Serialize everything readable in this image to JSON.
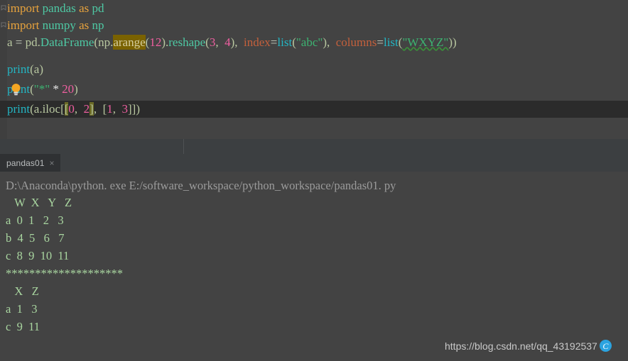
{
  "editor": {
    "lines": [
      {
        "id": "line-1",
        "tokens": [
          {
            "t": "import",
            "c": "kw"
          },
          {
            "t": " ",
            "c": "plain"
          },
          {
            "t": "pandas",
            "c": "ident"
          },
          {
            "t": " ",
            "c": "plain"
          },
          {
            "t": "as",
            "c": "kw"
          },
          {
            "t": " ",
            "c": "plain"
          },
          {
            "t": "pd",
            "c": "ident"
          }
        ],
        "text": "import pandas as pd"
      },
      {
        "id": "line-2",
        "tokens": [
          {
            "t": "import",
            "c": "kw"
          },
          {
            "t": " ",
            "c": "plain"
          },
          {
            "t": "numpy",
            "c": "ident"
          },
          {
            "t": " ",
            "c": "plain"
          },
          {
            "t": "as",
            "c": "kw"
          },
          {
            "t": " ",
            "c": "plain"
          },
          {
            "t": "np",
            "c": "ident"
          }
        ],
        "text": "import numpy as np"
      },
      {
        "id": "line-3",
        "tokens": [
          {
            "t": "a ",
            "c": "plain"
          },
          {
            "t": "= ",
            "c": "eq"
          },
          {
            "t": "pd",
            "c": "plain"
          },
          {
            "t": ".",
            "c": "punc"
          },
          {
            "t": "DataFrame",
            "c": "ident"
          },
          {
            "t": "(",
            "c": "punc"
          },
          {
            "t": "np",
            "c": "plain"
          },
          {
            "t": ".",
            "c": "punc"
          },
          {
            "t": "arange",
            "c": "arange-hl"
          },
          {
            "t": "(",
            "c": "punc"
          },
          {
            "t": "12",
            "c": "num"
          },
          {
            "t": ")",
            "c": "punc"
          },
          {
            "t": ".",
            "c": "punc"
          },
          {
            "t": "reshape",
            "c": "ident"
          },
          {
            "t": "(",
            "c": "punc"
          },
          {
            "t": "3",
            "c": "num"
          },
          {
            "t": ", ",
            "c": "punc"
          },
          {
            "t": " 4",
            "c": "num"
          },
          {
            "t": "), ",
            "c": "punc"
          },
          {
            "t": " index",
            "c": "kwarg"
          },
          {
            "t": "=",
            "c": "eq"
          },
          {
            "t": "list",
            "c": "fn"
          },
          {
            "t": "(",
            "c": "punc"
          },
          {
            "t": "\"abc\"",
            "c": "str"
          },
          {
            "t": "), ",
            "c": "punc"
          },
          {
            "t": " columns",
            "c": "kwarg"
          },
          {
            "t": "=",
            "c": "eq"
          },
          {
            "t": "list",
            "c": "fn"
          },
          {
            "t": "(",
            "c": "punc"
          },
          {
            "t": "\"WXYZ\"",
            "c": "str squiggle"
          },
          {
            "t": "))",
            "c": "punc"
          }
        ],
        "text": "a = pd.DataFrame(np.arange(12).reshape(3, 4), index=list(\"abc\"), columns=list(\"WXYZ\"))"
      },
      {
        "id": "line-4",
        "tokens": [
          {
            "t": "print",
            "c": "fn"
          },
          {
            "t": "(",
            "c": "punc"
          },
          {
            "t": "a",
            "c": "plain"
          },
          {
            "t": ")",
            "c": "punc"
          }
        ],
        "text": "print(a)"
      },
      {
        "id": "line-5",
        "tokens": [
          {
            "t": "print",
            "c": "fn"
          },
          {
            "t": "(",
            "c": "punc"
          },
          {
            "t": "\"*\"",
            "c": "str"
          },
          {
            "t": " ",
            "c": "plain"
          },
          {
            "t": "*",
            "c": "op"
          },
          {
            "t": " ",
            "c": "plain"
          },
          {
            "t": "20",
            "c": "num"
          },
          {
            "t": ")",
            "c": "punc"
          }
        ],
        "text": "print(\"*\" * 20)"
      },
      {
        "id": "line-6",
        "current": true,
        "tokens": [
          {
            "t": "print",
            "c": "fn"
          },
          {
            "t": "(",
            "c": "punc"
          },
          {
            "t": "a",
            "c": "plain"
          },
          {
            "t": ".",
            "c": "punc"
          },
          {
            "t": "iloc",
            "c": "plain"
          },
          {
            "t": "[",
            "c": "punc"
          },
          {
            "t": "[",
            "c": "bracket-hl"
          },
          {
            "t": "0",
            "c": "num"
          },
          {
            "t": ", ",
            "c": "punc"
          },
          {
            "t": " 2",
            "c": "num"
          },
          {
            "t": "]",
            "c": "bracket-hl"
          },
          {
            "t": ", ",
            "c": "punc"
          },
          {
            "t": " [",
            "c": "punc"
          },
          {
            "t": "1",
            "c": "num"
          },
          {
            "t": ", ",
            "c": "punc"
          },
          {
            "t": " 3",
            "c": "num"
          },
          {
            "t": "]])",
            "c": "punc"
          }
        ],
        "text": "print(a.iloc[[0, 2], [1, 3]])"
      }
    ]
  },
  "console_tab": {
    "label": "pandas01",
    "close_glyph": "×"
  },
  "console": {
    "command": "D:\\Anaconda\\python. exe E:/software_workspace/python_workspace/pandas01. py",
    "lines": [
      {
        "id": "out-header-1",
        "text": "   W  X   Y   Z",
        "kind": "data"
      },
      {
        "id": "out-row-a",
        "text": "a  0  1   2   3",
        "kind": "data"
      },
      {
        "id": "out-row-b",
        "text": "b  4  5   6   7",
        "kind": "data"
      },
      {
        "id": "out-row-c",
        "text": "c  8  9  10  11",
        "kind": "data"
      },
      {
        "id": "out-separator",
        "text": "********************",
        "kind": "data"
      },
      {
        "id": "out-header-2",
        "text": "   X   Z",
        "kind": "data"
      },
      {
        "id": "out-row2-a",
        "text": "a  1   3",
        "kind": "data"
      },
      {
        "id": "out-row2-c",
        "text": "c  9  11",
        "kind": "data"
      }
    ]
  },
  "watermark": {
    "url": "https://blog.csdn.net/qq_43192537",
    "badge": "C"
  }
}
